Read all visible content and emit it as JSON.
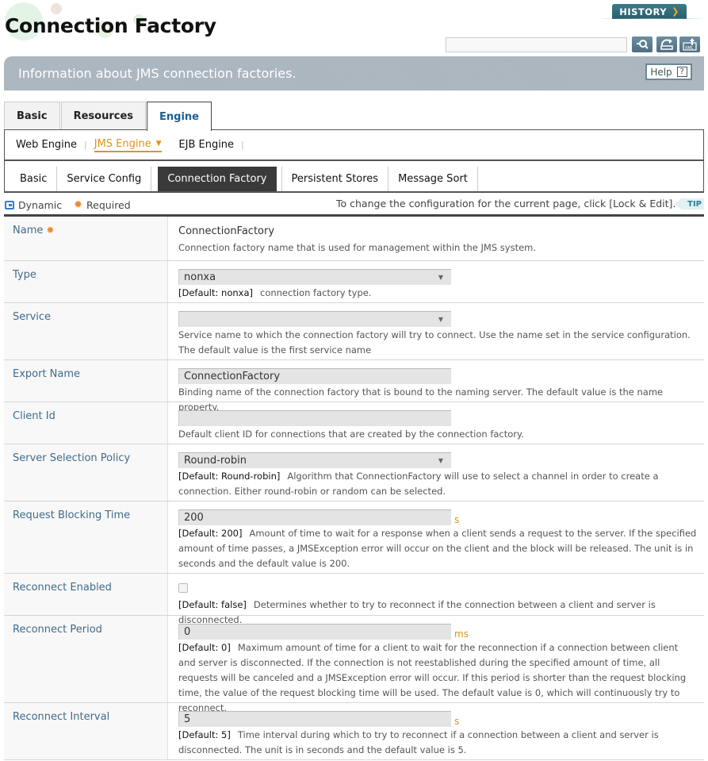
{
  "header": {
    "title": "Connection Factory",
    "history_label": "HISTORY",
    "search_placeholder": "",
    "info_text": "Information about JMS connection factories.",
    "help_label": "Help",
    "help_icon_glyph": "?"
  },
  "main_tabs": [
    {
      "label": "Basic"
    },
    {
      "label": "Resources"
    },
    {
      "label": "Engine",
      "active": true
    }
  ],
  "engine_tabs": [
    {
      "label": "Web Engine"
    },
    {
      "label": "JMS Engine",
      "active": true
    },
    {
      "label": "EJB Engine"
    }
  ],
  "sub_tabs": [
    {
      "label": "Basic"
    },
    {
      "label": "Service Config"
    },
    {
      "label": "Connection Factory",
      "active": true
    },
    {
      "label": "Persistent Stores"
    },
    {
      "label": "Message Sort"
    }
  ],
  "legend": {
    "dynamic": "Dynamic",
    "required": "Required",
    "tip_text": "To change the configuration for the current page, click [Lock & Edit].",
    "tip_badge": "TIP"
  },
  "colors": {
    "accent_orange": "#e0921d",
    "label_blue": "#3f6b8c",
    "active_tab_dark": "#3a3a3a"
  },
  "fields": {
    "name": {
      "label": "Name",
      "value": "ConnectionFactory",
      "desc": "Connection factory name that is used for management within the JMS system."
    },
    "type": {
      "label": "Type",
      "value": "nonxa",
      "default": "[Default: nonxa]",
      "desc": "connection factory type."
    },
    "service": {
      "label": "Service",
      "value": "",
      "desc": "Service name to which the connection factory will try to connect. Use the name set in the service configuration. The default value is the first service name"
    },
    "export_name": {
      "label": "Export Name",
      "value": "ConnectionFactory",
      "desc": "Binding name of the connection factory that is bound to the naming server. The default value is the name property."
    },
    "client_id": {
      "label": "Client Id",
      "value": "",
      "desc": "Default client ID for connections that are created by the connection factory."
    },
    "server_selection_policy": {
      "label": "Server Selection Policy",
      "value": "Round-robin",
      "default": "[Default: Round-robin]",
      "desc": "Algorithm that ConnectionFactory will use to select a channel in order to create a connection. Either round-robin or random can be selected."
    },
    "request_blocking_time": {
      "label": "Request Blocking Time",
      "value": "200",
      "unit": "s",
      "default": "[Default: 200]",
      "desc": "Amount of time to wait for a response when a client sends a request to the server. If the specified amount of time passes, a JMSException error will occur on the client and the block will be released. The unit is in seconds and the default value is 200."
    },
    "reconnect_enabled": {
      "label": "Reconnect Enabled",
      "checked": false,
      "default": "[Default: false]",
      "desc": "Determines whether to try to reconnect if the connection between a client and server is disconnected."
    },
    "reconnect_period": {
      "label": "Reconnect Period",
      "value": "0",
      "unit": "ms",
      "default": "[Default: 0]",
      "desc": "Maximum amount of time for a client to wait for the reconnection if a connection between client and server is disconnected. If the connection is not reestablished during the specified amount of time, all requests will be canceled and a JMSException error will occur. If this period is shorter than the request blocking time, the value of the request blocking time will be used. The default value is 0, which will continuously try to reconnect."
    },
    "reconnect_interval": {
      "label": "Reconnect Interval",
      "value": "5",
      "unit": "s",
      "default": "[Default: 5]",
      "desc": "Time interval during which to try to reconnect if a connection between a client and server is disconnected. The unit is in seconds and the default value is 5."
    }
  }
}
